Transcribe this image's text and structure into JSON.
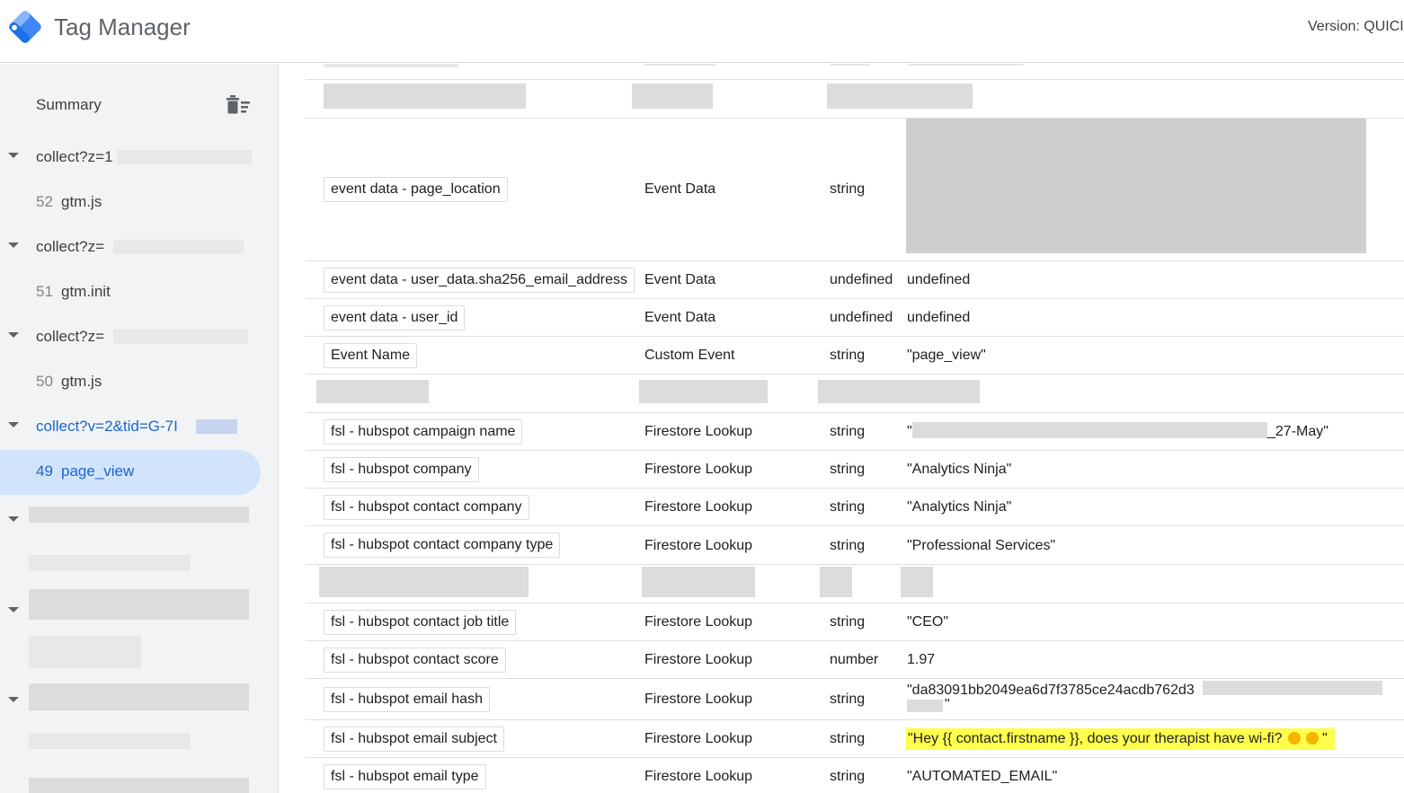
{
  "header": {
    "app_title": "Tag Manager",
    "version_label": "Version: QUICI"
  },
  "sidebar": {
    "summary_label": "Summary",
    "items": [
      {
        "label": "collect?z=1",
        "type": "event"
      },
      {
        "num": "52",
        "label": "gtm.js"
      },
      {
        "label": "collect?z=",
        "type": "event"
      },
      {
        "num": "51",
        "label": "gtm.init"
      },
      {
        "label": "collect?z=",
        "type": "event"
      },
      {
        "num": "50",
        "label": "gtm.js"
      },
      {
        "label": "collect?v=2&tid=G-7I",
        "type": "event"
      },
      {
        "num": "49",
        "label": "page_view"
      }
    ]
  },
  "variables": [
    {
      "name": "event data - page_location",
      "type": "Event Data",
      "return_type": "string",
      "value": ""
    },
    {
      "name": "event data - user_data.sha256_email_address",
      "type": "Event Data",
      "return_type": "undefined",
      "value": "undefined"
    },
    {
      "name": "event data - user_id",
      "type": "Event Data",
      "return_type": "undefined",
      "value": "undefined"
    },
    {
      "name": "Event Name",
      "type": "Custom Event",
      "return_type": "string",
      "value": "\"page_view\""
    },
    {
      "name": "fsl - hubspot campaign name",
      "type": "Firestore Lookup",
      "return_type": "string",
      "value": "_27-May\"",
      "value_prefix": "\""
    },
    {
      "name": "fsl - hubspot company",
      "type": "Firestore Lookup",
      "return_type": "string",
      "value": "\"Analytics Ninja\""
    },
    {
      "name": "fsl - hubspot contact company",
      "type": "Firestore Lookup",
      "return_type": "string",
      "value": "\"Analytics Ninja\""
    },
    {
      "name": "fsl - hubspot contact company type",
      "type": "Firestore Lookup",
      "return_type": "string",
      "value": "\"Professional Services\""
    },
    {
      "name": "fsl - hubspot contact job title",
      "type": "Firestore Lookup",
      "return_type": "string",
      "value": "\"CEO\""
    },
    {
      "name": "fsl - hubspot contact score",
      "type": "Firestore Lookup",
      "return_type": "number",
      "value": "1.97"
    },
    {
      "name": "fsl - hubspot email hash",
      "type": "Firestore Lookup",
      "return_type": "string",
      "value": "\"da83091bb2049ea6d7f3785ce24acdb762d3",
      "value_line2": "\""
    },
    {
      "name": "fsl - hubspot email subject",
      "type": "Firestore Lookup",
      "return_type": "string",
      "value": "\"Hey {{ contact.firstname }}, does your therapist have wi-fi?",
      "value_suffix": "\""
    },
    {
      "name": "fsl - hubspot email type",
      "type": "Firestore Lookup",
      "return_type": "string",
      "value": "\"AUTOMATED_EMAIL\""
    }
  ],
  "colors": {
    "accent": "#1967d2",
    "selected_bg": "#d2e3fc",
    "highlight": "#ffff4d"
  }
}
